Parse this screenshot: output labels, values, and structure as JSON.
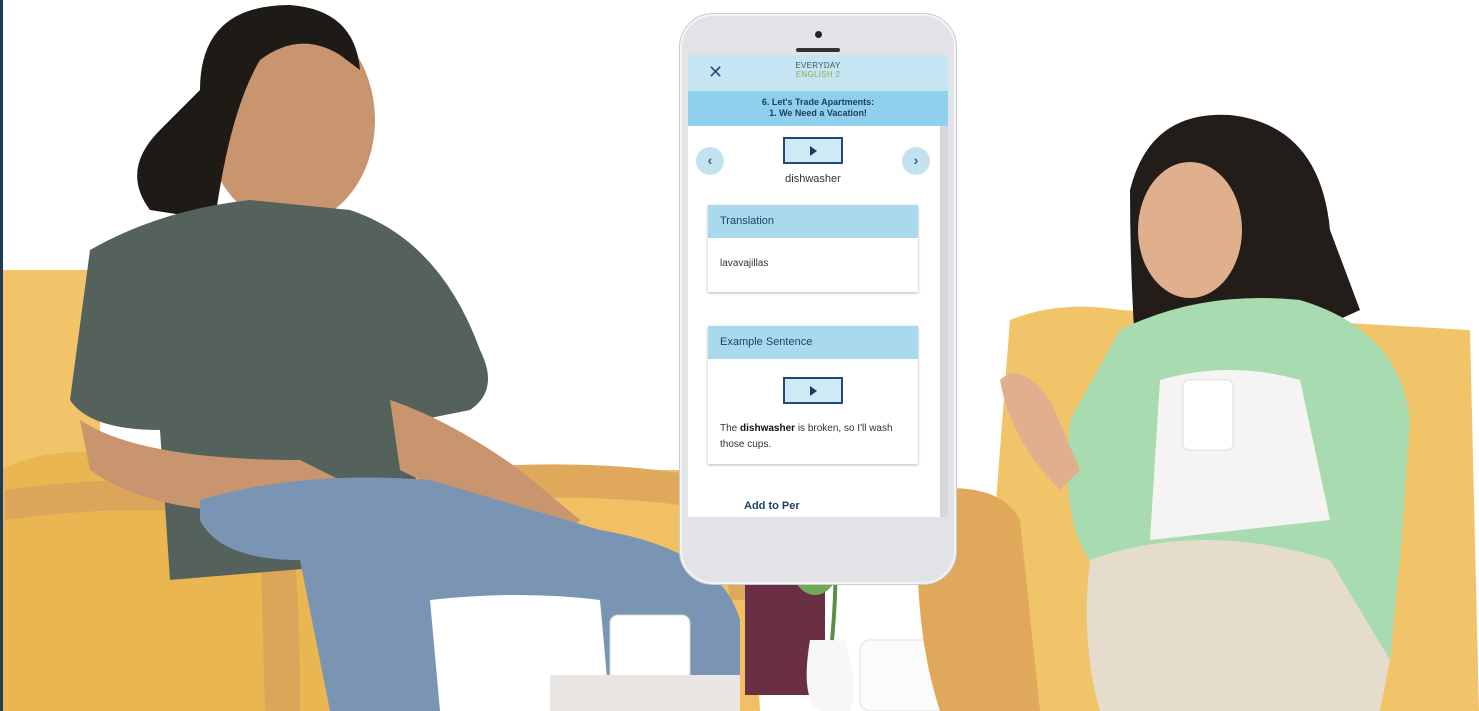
{
  "app": {
    "brand_line1": "EVERYDAY",
    "brand_line2": "ENGLISH 2",
    "close_label": "✕"
  },
  "lesson": {
    "title_line1": "6. Let's Trade Apartments:",
    "title_line2": "1. We Need a Vacation!"
  },
  "nav": {
    "prev_label": "‹",
    "next_label": "›"
  },
  "word": {
    "text": "dishwasher"
  },
  "translation": {
    "header": "Translation",
    "value": "lavavajillas"
  },
  "example": {
    "header": "Example Sentence",
    "sentence_prefix": "The",
    "sentence_keyword": "dishwasher",
    "sentence_rest": "is broken, so I'll wash those cups."
  },
  "actions": {
    "add_label": "Add to Per"
  },
  "colors": {
    "topbar": "#c6e5f2",
    "lesson_bar": "#8fd0ec",
    "card_header": "#a8d9ec",
    "play_border": "#1f4b78",
    "link": "#1e3f69"
  },
  "icons": [
    "close-icon",
    "chevron-left-icon",
    "chevron-right-icon",
    "play-icon"
  ]
}
